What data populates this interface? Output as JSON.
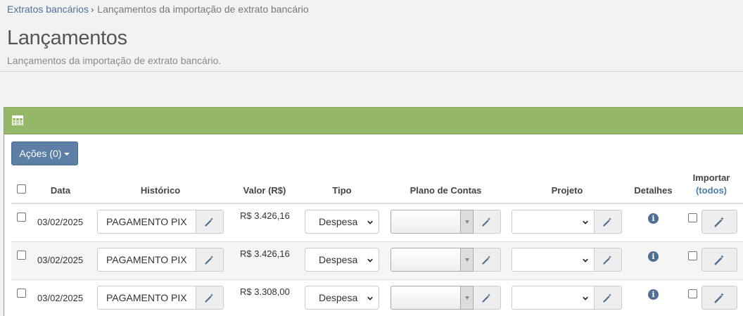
{
  "breadcrumb": {
    "parent": "Extratos bancários",
    "separator": "›",
    "current": "Lançamentos da importação de extrato bancário"
  },
  "page": {
    "title": "Lançamentos",
    "subtitle": "Lançamentos da importação de extrato bancário."
  },
  "panel": {
    "icon": "table-icon",
    "header_color": "#94b868"
  },
  "actions_button": {
    "label": "Ações (0)"
  },
  "table": {
    "headers": {
      "data": "Data",
      "historico": "Histórico",
      "valor": "Valor (R$)",
      "tipo": "Tipo",
      "plano": "Plano de Contas",
      "projeto": "Projeto",
      "detalhes": "Detalhes",
      "importar": "Importar",
      "todos": "(todos)"
    },
    "rows": [
      {
        "data": "03/02/2025",
        "historico": "PAGAMENTO PIX",
        "valor": "R$ 3.426,16",
        "tipo": "Despesa",
        "plano": "",
        "projeto": ""
      },
      {
        "data": "03/02/2025",
        "historico": "PAGAMENTO PIX",
        "valor": "R$ 3.426,16",
        "tipo": "Despesa",
        "plano": "",
        "projeto": ""
      },
      {
        "data": "03/02/2025",
        "historico": "PAGAMENTO PIX",
        "valor": "R$ 3.308,00",
        "tipo": "Despesa",
        "plano": "",
        "projeto": ""
      }
    ]
  },
  "colors": {
    "primary": "#5d7fa6",
    "link": "#4f7097",
    "info": "#4f6f94"
  }
}
